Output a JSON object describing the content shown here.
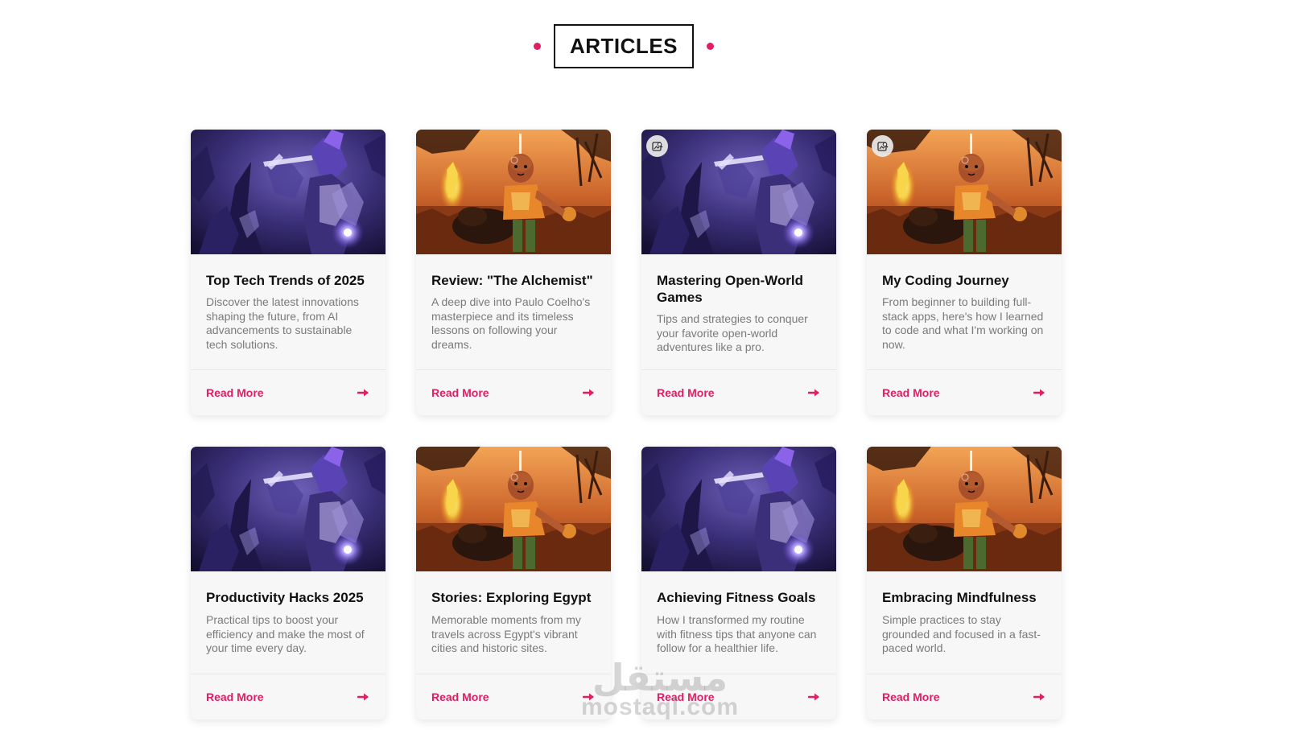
{
  "section": {
    "title": "ARTICLES"
  },
  "colors": {
    "accent": "#e01e64",
    "card_bg": "#f7f7f7",
    "text_dark": "#111111",
    "text_muted": "#7a7a7a"
  },
  "cards": [
    {
      "title": "Top Tech Trends of 2025",
      "description": "Discover the latest innovations shaping the future, from AI advancements to sustainable tech solutions.",
      "link_label": "Read More",
      "image": "dark-fantasy-warrior",
      "badge": false
    },
    {
      "title": "Review: \"The Alchemist\"",
      "description": "A deep dive into Paulo Coelho's masterpiece and its timeless lessons on following your dreams.",
      "link_label": "Read More",
      "image": "savanna-bear-character",
      "badge": false
    },
    {
      "title": "Mastering Open-World Games",
      "description": "Tips and strategies to conquer your favorite open-world adventures like a pro.",
      "link_label": "Read More",
      "image": "dark-fantasy-warrior",
      "badge": true
    },
    {
      "title": "My Coding Journey",
      "description": "From beginner to building full-stack apps, here's how I learned to code and what I'm working on now.",
      "link_label": "Read More",
      "image": "savanna-bear-character",
      "badge": true
    },
    {
      "title": "Productivity Hacks 2025",
      "description": "Practical tips to boost your efficiency and make the most of your time every day.",
      "link_label": "Read More",
      "image": "dark-fantasy-warrior",
      "badge": false
    },
    {
      "title": "Stories: Exploring Egypt",
      "description": "Memorable moments from my travels across Egypt's vibrant cities and historic sites.",
      "link_label": "Read More",
      "image": "savanna-bear-character",
      "badge": false
    },
    {
      "title": "Achieving Fitness Goals",
      "description": "How I transformed my routine with fitness tips that anyone can follow for a healthier life.",
      "link_label": "Read More",
      "image": "dark-fantasy-warrior",
      "badge": false
    },
    {
      "title": "Embracing Mindfulness",
      "description": "Simple practices to stay grounded and focused in a fast-paced world.",
      "link_label": "Read More",
      "image": "savanna-bear-character",
      "badge": false
    }
  ],
  "watermark": {
    "arabic": "مستقل",
    "latin": "mostaql.com"
  }
}
